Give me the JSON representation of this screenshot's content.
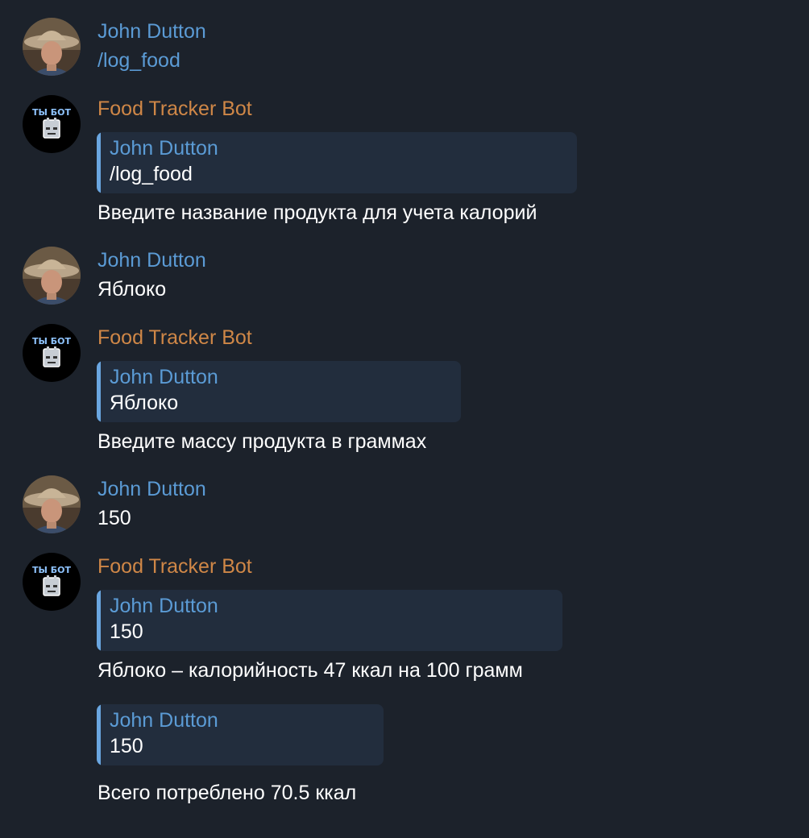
{
  "colors": {
    "background": "#1c222b",
    "user_name": "#5b9bd5",
    "bot_name": "#cf8747",
    "reply_bg": "#222d3d",
    "reply_bar": "#6aa6e0",
    "text": "#ffffff"
  },
  "user": {
    "name": "John Dutton",
    "avatar_icon": "cowboy-hat-photo"
  },
  "bot": {
    "name": "Food Tracker Bot",
    "avatar_icon": "ty-bot-logo",
    "avatar_text": "ТЫ БОТ"
  },
  "messages": [
    {
      "text": "/log_food"
    },
    {
      "reply_to": {
        "name": "John Dutton",
        "text": "/log_food"
      },
      "text": "Введите название продукта для учета калорий"
    },
    {
      "text": "Яблоко"
    },
    {
      "reply_to": {
        "name": "John Dutton",
        "text": "Яблоко"
      },
      "text": "Введите массу продукта в граммах"
    },
    {
      "text": "150"
    },
    {
      "reply_to": {
        "name": "John Dutton",
        "text": "150"
      },
      "text": "Яблоко – калорийность 47 ккал на 100 грамм"
    },
    {
      "reply_to": {
        "name": "John Dutton",
        "text": "150"
      },
      "text": "Всего потреблено 70.5 ккал"
    }
  ]
}
